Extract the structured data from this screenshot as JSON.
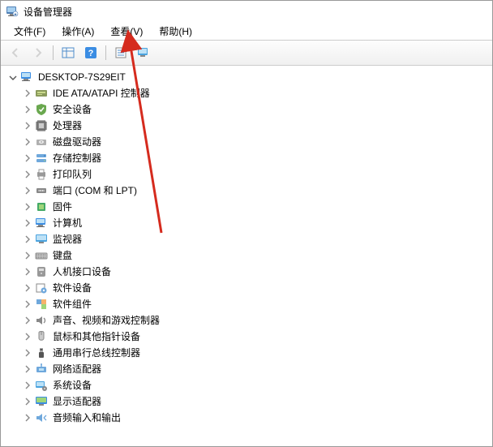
{
  "window_title": "设备管理器",
  "menu": {
    "file": "文件(F)",
    "action": "操作(A)",
    "view": "查看(V)",
    "help": "帮助(H)"
  },
  "toolbar": [
    {
      "name": "back-button",
      "icon": "arrow-left",
      "enabled": false
    },
    {
      "name": "forward-button",
      "icon": "arrow-right",
      "enabled": false
    },
    {
      "sep": true
    },
    {
      "name": "show-hide-console-button",
      "icon": "console-tree"
    },
    {
      "name": "help-button",
      "icon": "help"
    },
    {
      "sep": true
    },
    {
      "name": "properties-button",
      "icon": "properties"
    },
    {
      "name": "scan-hardware-button",
      "icon": "scan-monitor"
    }
  ],
  "root": {
    "label": "DESKTOP-7S29EIT",
    "icon": "computer",
    "expanded": true,
    "children": [
      {
        "label": "IDE ATA/ATAPI 控制器",
        "icon": "ide"
      },
      {
        "label": "安全设备",
        "icon": "security"
      },
      {
        "label": "处理器",
        "icon": "cpu"
      },
      {
        "label": "磁盘驱动器",
        "icon": "disk"
      },
      {
        "label": "存储控制器",
        "icon": "storage"
      },
      {
        "label": "打印队列",
        "icon": "printer"
      },
      {
        "label": "端口 (COM 和 LPT)",
        "icon": "port"
      },
      {
        "label": "固件",
        "icon": "firmware"
      },
      {
        "label": "计算机",
        "icon": "computer"
      },
      {
        "label": "监视器",
        "icon": "monitor"
      },
      {
        "label": "键盘",
        "icon": "keyboard"
      },
      {
        "label": "人机接口设备",
        "icon": "hid"
      },
      {
        "label": "软件设备",
        "icon": "software"
      },
      {
        "label": "软件组件",
        "icon": "software-component"
      },
      {
        "label": "声音、视频和游戏控制器",
        "icon": "audio"
      },
      {
        "label": "鼠标和其他指针设备",
        "icon": "mouse"
      },
      {
        "label": "通用串行总线控制器",
        "icon": "usb"
      },
      {
        "label": "网络适配器",
        "icon": "network"
      },
      {
        "label": "系统设备",
        "icon": "system"
      },
      {
        "label": "显示适配器",
        "icon": "display"
      },
      {
        "label": "音频输入和输出",
        "icon": "audio-io"
      }
    ]
  },
  "annotation": {
    "target_menu": "view",
    "color": "#d52b1e"
  }
}
